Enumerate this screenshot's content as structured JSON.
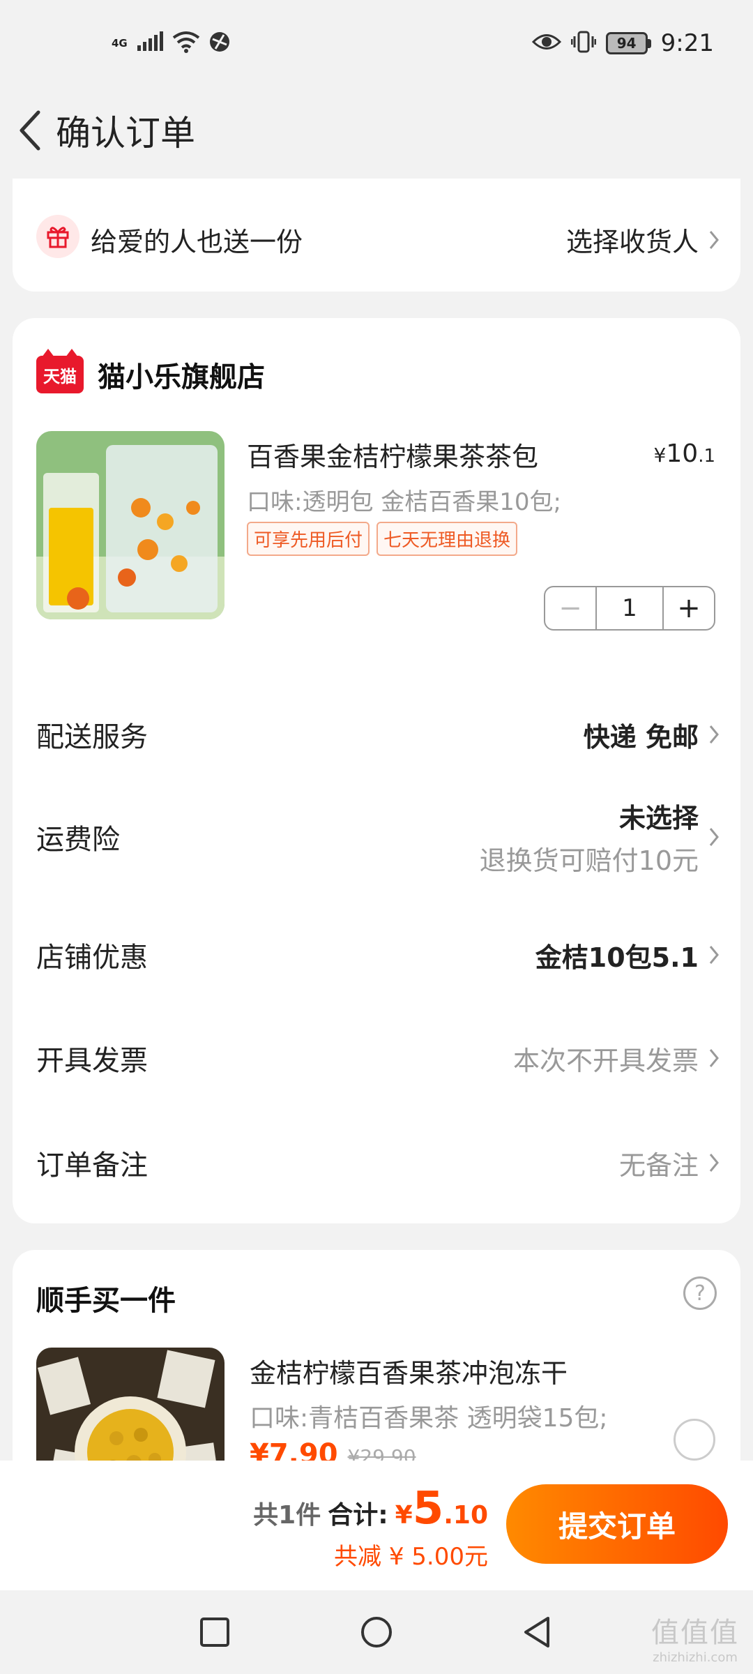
{
  "status_bar": {
    "network_label": "4G",
    "battery_level": "94",
    "time": "9:21"
  },
  "header": {
    "title": "确认订单"
  },
  "gift": {
    "text": "给爱的人也送一份",
    "action": "选择收货人"
  },
  "store": {
    "logo_text": "天猫",
    "name": "猫小乐旗舰店"
  },
  "product": {
    "title": "百香果金桔柠檬果茶茶包",
    "price_symbol": "¥",
    "price_int": "10",
    "price_dec": ".1",
    "spec": "口味:透明包 金桔百香果10包;",
    "tags": [
      "可享先用后付",
      "七天无理由退换"
    ],
    "quantity": "1",
    "minus": "−",
    "plus": "+"
  },
  "options": {
    "delivery": {
      "label": "配送服务",
      "value": "快递 免邮"
    },
    "shipping_insurance": {
      "label": "运费险",
      "value": "未选择",
      "sub": "退换货可赔付10元"
    },
    "store_discount": {
      "label": "店铺优惠",
      "value": "金桔10包5.1"
    },
    "invoice": {
      "label": "开具发票",
      "value": "本次不开具发票"
    },
    "note": {
      "label": "订单备注",
      "value": "无备注"
    }
  },
  "addon": {
    "title": "顺手买一件",
    "help": "?",
    "name": "金桔柠檬百香果茶冲泡冻干",
    "spec": "口味:青桔百香果茶 透明袋15包;",
    "price": "¥7.90",
    "original_price": "¥29.90"
  },
  "checkout": {
    "count_text": "共1件",
    "total_label": "合计:",
    "total_symbol": "¥",
    "total_int": "5",
    "total_dec": ".10",
    "discount_text": "共减 ¥ 5.00元",
    "submit_label": "提交订单"
  },
  "watermark": {
    "main": "值值值",
    "sub": "zhizhizhi.com"
  },
  "colors": {
    "accent": "#ff4a00",
    "tmall_red": "#e8192c",
    "background": "#f2f2f2"
  }
}
